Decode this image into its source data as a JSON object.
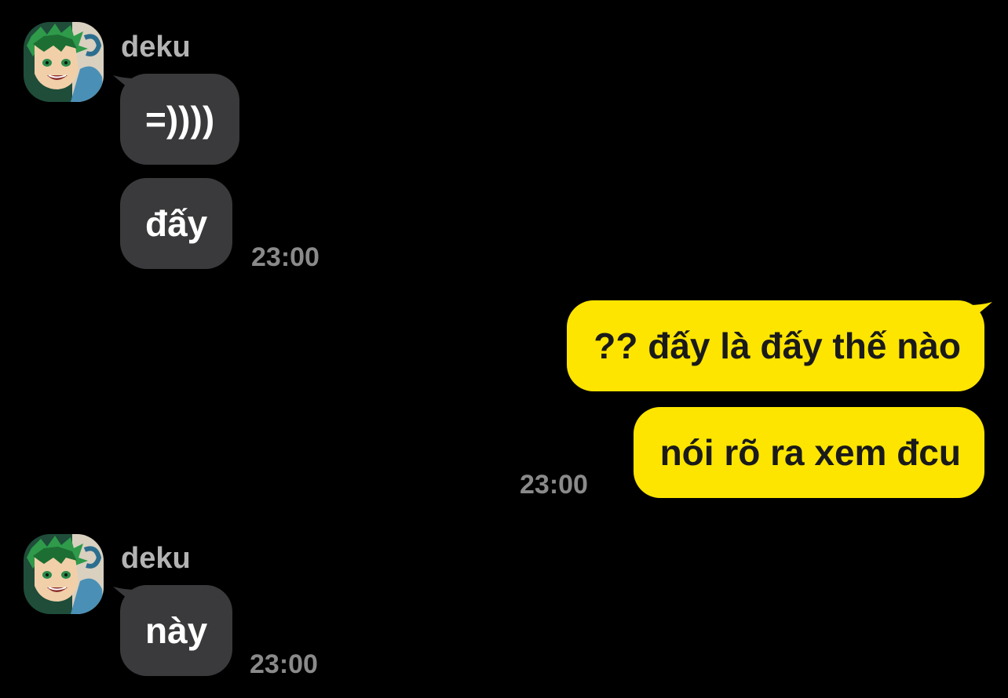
{
  "conversation": {
    "groups": [
      {
        "sender": "deku",
        "messages": [
          "=))))",
          "đấy"
        ],
        "time": "23:00"
      },
      {
        "sender": "me",
        "messages": [
          "?? đấy là đấy thế nào",
          "nói rõ ra xem đcu"
        ],
        "time": "23:00"
      },
      {
        "sender": "deku",
        "messages": [
          "này"
        ],
        "time": "23:00"
      }
    ]
  },
  "theme": {
    "background": "#000000",
    "incoming_bubble": "#3a3a3c",
    "outgoing_bubble": "#fee500",
    "sender_name_color": "#b3b3b3",
    "timestamp_color": "#8a8a8a"
  },
  "avatar_icon": "anime-character-avatar-icon"
}
